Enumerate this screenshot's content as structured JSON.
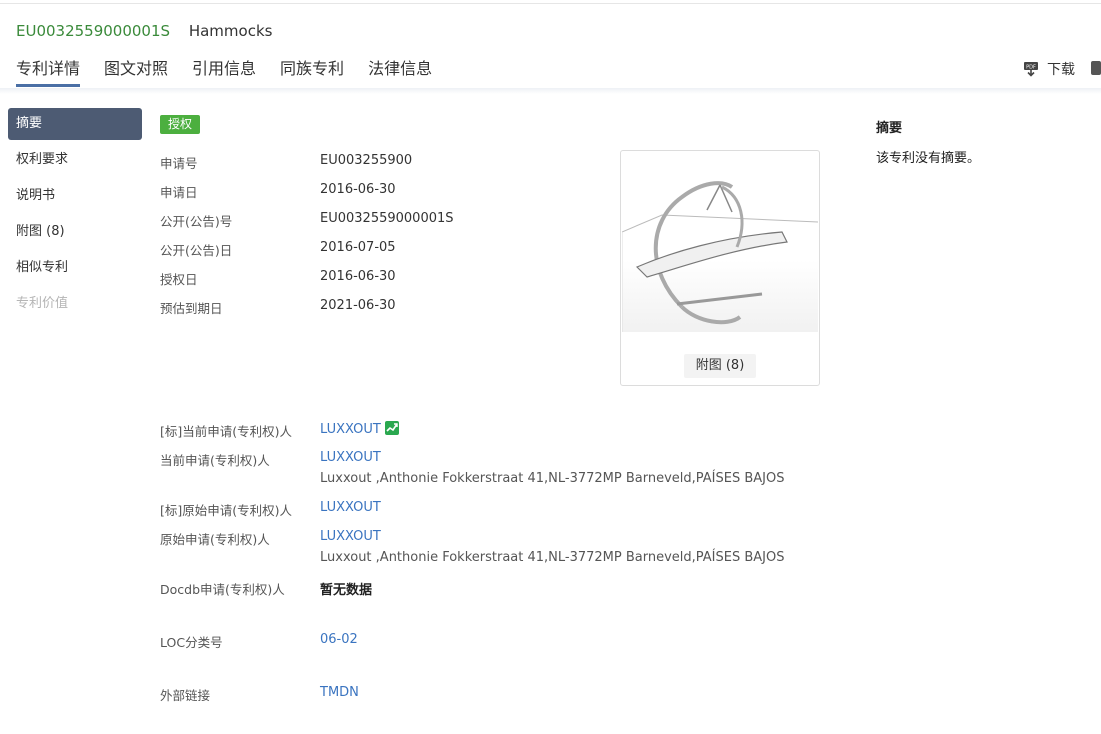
{
  "header": {
    "pub_number": "EU0032559000001S",
    "title": "Hammocks"
  },
  "tabs": [
    "专利详情",
    "图文对照",
    "引用信息",
    "同族专利",
    "法律信息"
  ],
  "toolbar": {
    "download_label": "下载"
  },
  "sidebar": {
    "items": [
      {
        "label": "摘要",
        "state": "active"
      },
      {
        "label": "权利要求",
        "state": "normal"
      },
      {
        "label": "说明书",
        "state": "normal"
      },
      {
        "label": "附图 (8)",
        "state": "normal"
      },
      {
        "label": "相似专利",
        "state": "normal"
      },
      {
        "label": "专利价值",
        "state": "disabled"
      }
    ]
  },
  "status_badge": "授权",
  "details": {
    "app_no": {
      "label": "申请号",
      "value": "EU003255900"
    },
    "app_date": {
      "label": "申请日",
      "value": "2016-06-30"
    },
    "pub_no": {
      "label": "公开(公告)号",
      "value": "EU0032559000001S"
    },
    "pub_date": {
      "label": "公开(公告)日",
      "value": "2016-07-05"
    },
    "grant_date": {
      "label": "授权日",
      "value": "2016-06-30"
    },
    "expiry_date": {
      "label": "预估到期日",
      "value": "2021-06-30"
    }
  },
  "applicants": {
    "std_current": {
      "label": "[标]当前申请(专利权)人",
      "value": "LUXXOUT"
    },
    "current": {
      "label": "当前申请(专利权)人",
      "value": "LUXXOUT",
      "address": "Luxxout ,Anthonie Fokkerstraat 41,NL-3772MP Barneveld,PAÍSES BAJOS"
    },
    "std_original": {
      "label": "[标]原始申请(专利权)人",
      "value": "LUXXOUT"
    },
    "original": {
      "label": "原始申请(专利权)人",
      "value": "LUXXOUT",
      "address": "Luxxout ,Anthonie Fokkerstraat 41,NL-3772MP Barneveld,PAÍSES BAJOS"
    },
    "docdb": {
      "label": "Docdb申请(专利权)人",
      "value": "暂无数据"
    }
  },
  "classification": {
    "label": "LOC分类号",
    "value": "06-02"
  },
  "external": {
    "label": "外部链接",
    "value": "TMDN"
  },
  "figure": {
    "button_label": "附图 (8)"
  },
  "abstract": {
    "title": "摘要",
    "text": "该专利没有摘要。"
  },
  "colors": {
    "accent": "#4a6fa5",
    "badge_green": "#4caf3f",
    "link": "#3a74c0",
    "nav_active_bg": "#4d5b73",
    "pub_number_green": "#3a8a3a"
  },
  "icons": [
    "download-icon",
    "chart-icon",
    "hammock-drawing"
  ]
}
